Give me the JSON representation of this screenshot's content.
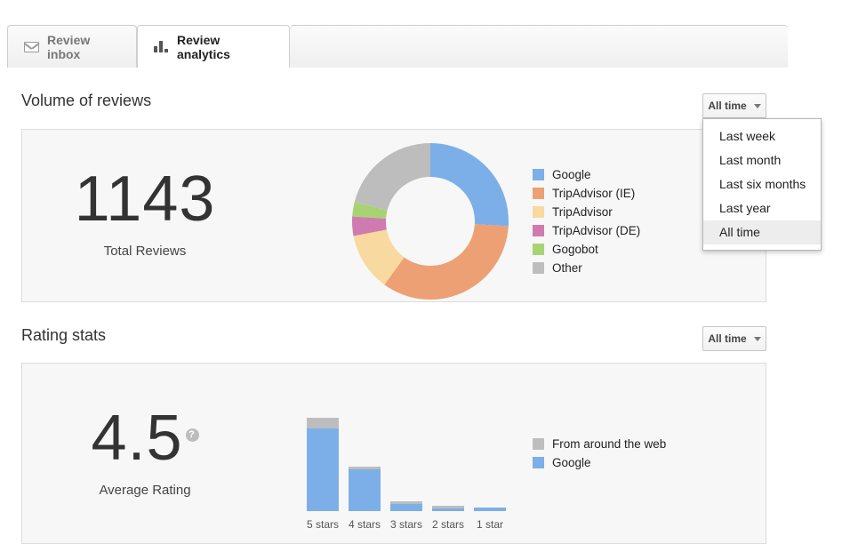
{
  "tabs": [
    {
      "label": "Review inbox",
      "icon": "envelope-icon",
      "active": false
    },
    {
      "label": "Review analytics",
      "icon": "bar-chart-icon",
      "active": true
    }
  ],
  "sections": {
    "volume": {
      "title": "Volume of reviews",
      "range_button": "All time",
      "total_value": "1143",
      "total_label": "Total Reviews"
    },
    "rating": {
      "title": "Rating stats",
      "range_button": "All time",
      "average_value": "4.5",
      "average_label": "Average Rating",
      "help_glyph": "?"
    }
  },
  "dropdown": {
    "open": true,
    "options": [
      {
        "label": "Last week",
        "selected": false
      },
      {
        "label": "Last month",
        "selected": false
      },
      {
        "label": "Last six months",
        "selected": false
      },
      {
        "label": "Last year",
        "selected": false
      },
      {
        "label": "All time",
        "selected": true
      }
    ]
  },
  "colors": {
    "google_blue": "#7cafe8",
    "tripadvisor_ie": "#eda濃"
  },
  "chart_data": [
    {
      "type": "pie",
      "title": "Volume of reviews",
      "subtitle": "1143 Total Reviews",
      "donut": true,
      "legend_position": "right",
      "total": 1143,
      "labels": [
        "Google",
        "TripAdvisor (IE)",
        "TripAdvisor",
        "TripAdvisor (DE)",
        "Gogobot",
        "Other"
      ],
      "colors": [
        "#7cafe8",
        "#eda073",
        "#f8d9a0",
        "#cf7bb0",
        "#a8d373",
        "#bdbdbd"
      ],
      "values": [
        26,
        34,
        12,
        4,
        3,
        21
      ],
      "unit": "percent"
    },
    {
      "type": "bar",
      "title": "Rating stats",
      "subtitle": "4.5 Average Rating",
      "stacked": true,
      "legend_position": "right",
      "categories": [
        "5 stars",
        "4 stars",
        "3 stars",
        "2 stars",
        "1 star"
      ],
      "series": [
        {
          "name": "Google",
          "color": "#7cafe8",
          "values": [
            93,
            47,
            8,
            1,
            4
          ]
        },
        {
          "name": "From around the web",
          "color": "#bdbdbd",
          "values": [
            12,
            3,
            3,
            2,
            0
          ]
        }
      ],
      "xlabel": "",
      "ylabel": "",
      "ylim": [
        0,
        110
      ],
      "grid": false
    }
  ]
}
